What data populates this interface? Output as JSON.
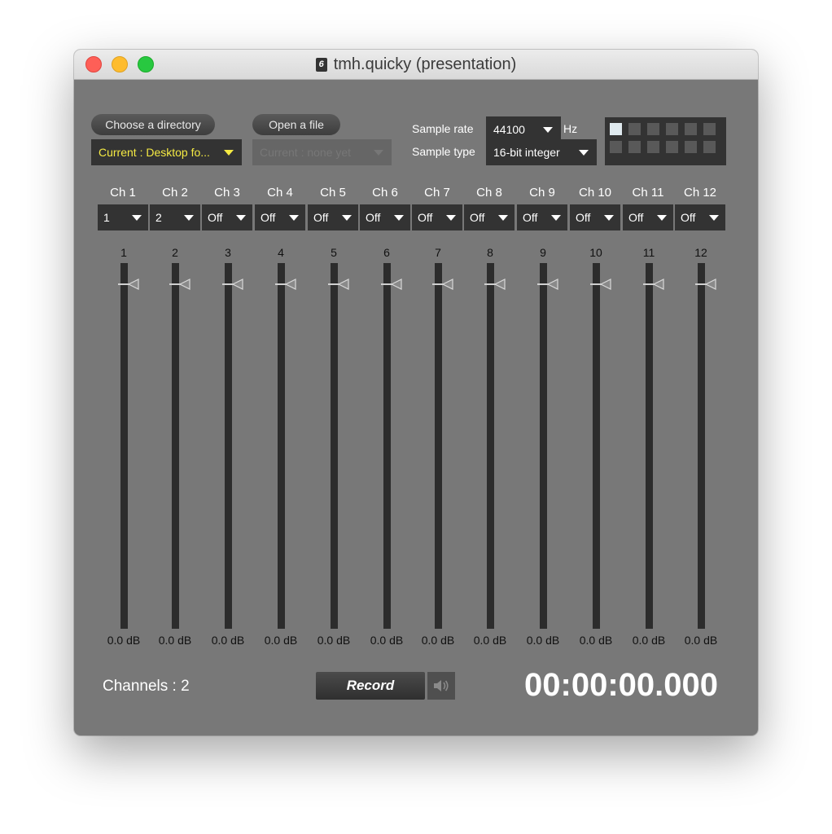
{
  "window": {
    "title": "tmh.quicky (presentation)",
    "doc_icon_glyph": "6"
  },
  "controls": {
    "choose_dir_label": "Choose a directory",
    "open_file_label": "Open a file",
    "current_dir": "Current : Desktop fo...",
    "current_file": "Current : none yet",
    "sample_rate_label": "Sample rate",
    "sample_rate_value": "44100",
    "sample_rate_unit": "Hz",
    "sample_type_label": "Sample type",
    "sample_type_value": "16-bit integer"
  },
  "matrix": {
    "rows": 2,
    "cols": 6,
    "active_cells": [
      [
        0,
        0
      ]
    ]
  },
  "channels": [
    {
      "label": "Ch 1",
      "input": "1",
      "slider": "1",
      "db": "0.0 dB"
    },
    {
      "label": "Ch 2",
      "input": "2",
      "slider": "2",
      "db": "0.0 dB"
    },
    {
      "label": "Ch 3",
      "input": "Off",
      "slider": "3",
      "db": "0.0 dB"
    },
    {
      "label": "Ch 4",
      "input": "Off",
      "slider": "4",
      "db": "0.0 dB"
    },
    {
      "label": "Ch 5",
      "input": "Off",
      "slider": "5",
      "db": "0.0 dB"
    },
    {
      "label": "Ch 6",
      "input": "Off",
      "slider": "6",
      "db": "0.0 dB"
    },
    {
      "label": "Ch 7",
      "input": "Off",
      "slider": "7",
      "db": "0.0 dB"
    },
    {
      "label": "Ch 8",
      "input": "Off",
      "slider": "8",
      "db": "0.0 dB"
    },
    {
      "label": "Ch 9",
      "input": "Off",
      "slider": "9",
      "db": "0.0 dB"
    },
    {
      "label": "Ch 10",
      "input": "Off",
      "slider": "10",
      "db": "0.0 dB"
    },
    {
      "label": "Ch 11",
      "input": "Off",
      "slider": "11",
      "db": "0.0 dB"
    },
    {
      "label": "Ch 12",
      "input": "Off",
      "slider": "12",
      "db": "0.0 dB"
    }
  ],
  "footer": {
    "channels_count": "Channels : 2",
    "record_label": "Record",
    "timer": "00:00:00.000"
  },
  "icons": {
    "speaker": "speaker-icon",
    "slider_thumb": "triangle-left-icon"
  }
}
